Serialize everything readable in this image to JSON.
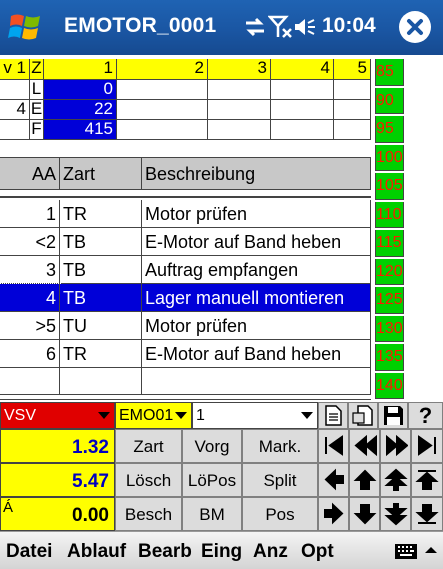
{
  "titlebar": {
    "title": "EMOTOR_0001",
    "time": "10:04",
    "icons": [
      "windows-start-icon",
      "sync-icon",
      "signal-off-icon",
      "speaker-icon",
      "close-icon"
    ]
  },
  "top_grid": {
    "header": [
      "v 1",
      "Z",
      "1",
      "2",
      "3",
      "4",
      "5"
    ],
    "rows": [
      {
        "num": "",
        "letter": "L",
        "value": "0"
      },
      {
        "num": "4",
        "letter": "E",
        "value": "22"
      },
      {
        "num": "",
        "letter": "F",
        "value": "415"
      }
    ]
  },
  "scale": [
    "85",
    "90",
    "95",
    "100",
    "105",
    "110",
    "115",
    "120",
    "125",
    "130",
    "135",
    "140"
  ],
  "table": {
    "columns": [
      "AA",
      "Zart",
      "Beschreibung"
    ],
    "rows": [
      {
        "aa": "1",
        "zart": "TR",
        "desc": "Motor prüfen"
      },
      {
        "aa": "<2",
        "zart": "TB",
        "desc": "E-Motor auf Band heben"
      },
      {
        "aa": "3",
        "zart": "TB",
        "desc": "Auftrag empfangen"
      },
      {
        "aa": "4",
        "zart": "TB",
        "desc": "Lager manuell montieren"
      },
      {
        "aa": ">5",
        "zart": "TU",
        "desc": "Motor prüfen"
      },
      {
        "aa": "6",
        "zart": "TR",
        "desc": "E-Motor auf Band heben"
      }
    ],
    "selected_row": 3
  },
  "controls": {
    "select1": "VSV",
    "select2": "EMO01",
    "select3": "1",
    "values": [
      "1.32",
      "5.47",
      "0.00"
    ],
    "value3_prefix": "Á",
    "buttons": [
      [
        "Zart",
        "Vorg",
        "Mark."
      ],
      [
        "Lösch",
        "LöPos",
        "Split"
      ],
      [
        "Besch",
        "BM",
        "Pos"
      ]
    ],
    "question": "?"
  },
  "menu": {
    "items": [
      "Datei",
      "Ablauf",
      "Bearb",
      "Eing",
      "Anz",
      "Opt"
    ]
  },
  "colors": {
    "titlebar": "#1a56a3",
    "selection": "#0000d8",
    "highlight": "#ffff00",
    "scale_bg": "#00d000",
    "scale_text": "#ff1a00",
    "header_gray": "#c8c8c8"
  }
}
